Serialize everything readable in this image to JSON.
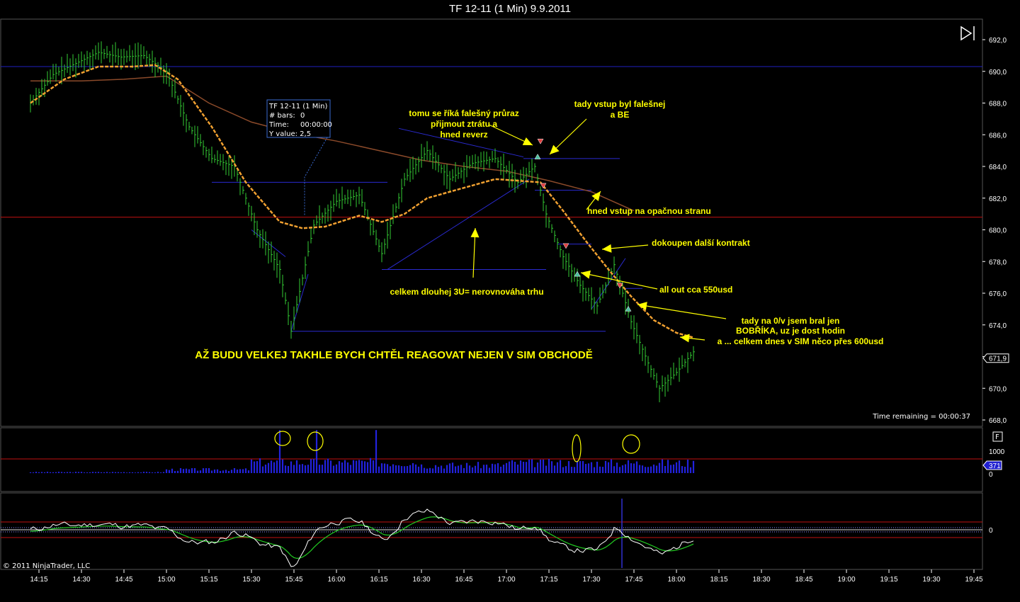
{
  "window": {
    "title": "TF 12-11 (1 Min)  9.9.2011"
  },
  "colors": {
    "background": "#000000",
    "price_bars": "#33cc33",
    "fast_ma": "#f0a030",
    "slow_ma": "#8b4a2a",
    "volume": "#2222dd",
    "hline_blue": "#2020c0",
    "hline_red": "#c01010",
    "annotation": "#ffff00",
    "osc_white": "#ffffff",
    "osc_green": "#22cc22"
  },
  "chart_data": {
    "type": "line",
    "title": "TF 12-11 (1 Min)  9.9.2011",
    "price_axis": {
      "ticks": [
        "692,0",
        "690,0",
        "688,0",
        "686,0",
        "684,0",
        "682,0",
        "680,0",
        "678,0",
        "676,0",
        "674,0",
        "672,0",
        "670,0",
        "668,0"
      ],
      "ylim": [
        667.5,
        692.5
      ],
      "last_price_label": "671,9"
    },
    "time_axis": {
      "ticks": [
        "14:15",
        "14:30",
        "14:45",
        "15:00",
        "15:15",
        "15:30",
        "15:45",
        "16:00",
        "16:15",
        "16:30",
        "16:45",
        "17:00",
        "17:15",
        "17:30",
        "17:45",
        "18:00",
        "18:15",
        "18:30",
        "18:45",
        "19:00",
        "19:15",
        "19:30",
        "19:45"
      ]
    },
    "price_series": {
      "name": "TF 12-11",
      "x": [
        "14:12",
        "14:20",
        "14:28",
        "14:36",
        "14:44",
        "14:52",
        "15:00",
        "15:08",
        "15:16",
        "15:24",
        "15:32",
        "15:40",
        "15:44",
        "15:52",
        "16:00",
        "16:08",
        "16:16",
        "16:24",
        "16:32",
        "16:40",
        "16:48",
        "16:56",
        "17:04",
        "17:10",
        "17:14",
        "17:20",
        "17:26",
        "17:32",
        "17:38",
        "17:44",
        "17:50",
        "17:54",
        "18:00",
        "18:06"
      ],
      "values": [
        688.0,
        689.8,
        690.5,
        691.2,
        690.9,
        691.0,
        690.0,
        686.5,
        684.5,
        684.0,
        680.0,
        677.5,
        673.6,
        680.3,
        681.8,
        682.2,
        678.5,
        683.2,
        685.0,
        683.2,
        684.2,
        684.5,
        683.0,
        684.0,
        681.0,
        678.3,
        676.5,
        675.2,
        677.8,
        674.2,
        671.6,
        670.0,
        671.0,
        672.3
      ]
    },
    "fast_ma": {
      "x": [
        "14:12",
        "14:24",
        "14:36",
        "14:48",
        "14:56",
        "15:04",
        "15:16",
        "15:28",
        "15:40",
        "15:48",
        "15:56",
        "16:08",
        "16:16",
        "16:24",
        "16:32",
        "16:44",
        "16:56",
        "17:04",
        "17:12",
        "17:20",
        "17:28",
        "17:36",
        "17:44",
        "17:52",
        "18:00",
        "18:06"
      ],
      "values": [
        688.0,
        689.5,
        690.3,
        690.3,
        690.4,
        689.5,
        686.5,
        683.0,
        680.5,
        680.1,
        680.2,
        680.9,
        680.5,
        681.0,
        682.0,
        682.6,
        683.2,
        683.1,
        683.0,
        681.2,
        679.3,
        677.5,
        675.8,
        674.3,
        673.5,
        673.2
      ]
    },
    "slow_ma": {
      "x": [
        "14:12",
        "14:30",
        "14:45",
        "15:00",
        "15:15",
        "15:30",
        "15:45",
        "16:00",
        "16:15",
        "16:30",
        "16:45",
        "17:00",
        "17:15",
        "17:30",
        "17:45"
      ],
      "values": [
        689.4,
        689.4,
        689.5,
        689.7,
        688.0,
        686.8,
        686.1,
        685.6,
        685.0,
        684.4,
        684.0,
        683.7,
        683.1,
        682.4,
        681.2
      ]
    },
    "horizontal_levels": {
      "blue": 690.3,
      "red": 680.8
    },
    "volume_axis": {
      "ticks": [
        "1000",
        "0"
      ],
      "last_value_label": "371"
    },
    "oscillator_axis": {
      "ticks": [
        "0"
      ]
    },
    "status": {
      "time_remaining": "Time remaining = 00:00:37",
      "copyright": "© 2011 NinjaTrader, LLC"
    },
    "tooltip": {
      "title": "TF 12-11 (1 Min)",
      "bars_label": "# bars:",
      "bars_value": "0",
      "time_label": "Time:",
      "time_value": "00:00:00",
      "y_label": "Y value: 2,5"
    },
    "volume_panel_flag": "F",
    "annotations": [
      {
        "text": "tomu se říká falešný průraz"
      },
      {
        "text": "přijmout ztrátu a"
      },
      {
        "text": "hned reverz"
      },
      {
        "text": "tady vstup byl falešnej"
      },
      {
        "text": "a BE"
      },
      {
        "text": "hned vstup na opačnou stranu"
      },
      {
        "text": "dokoupen další kontrakt"
      },
      {
        "text": "all out cca 550usd"
      },
      {
        "text": "tady na 0/v jsem bral jen"
      },
      {
        "text": "BOBŘÍKA, uz je dost hodin"
      },
      {
        "text": "a ... celkem dnes v SIM něco přes 600usd"
      },
      {
        "text": "celkem dlouhej 3U= nerovnováha trhu"
      },
      {
        "text": "AŽ BUDU VELKEJ TAKHLE BYCH CHTĚL REAGOVAT NEJEN V SIM OBCHODĚ"
      }
    ]
  }
}
